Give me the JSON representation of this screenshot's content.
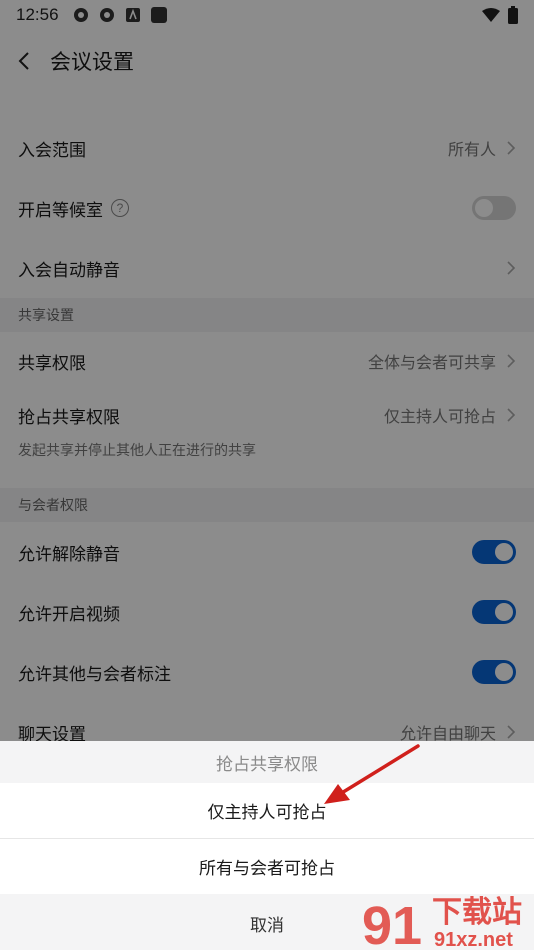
{
  "status_bar": {
    "time": "12:56"
  },
  "nav": {
    "title": "会议设置"
  },
  "rows": {
    "range_label": "入会范围",
    "range_value": "所有人",
    "waiting_label": "开启等候室",
    "help_glyph": "?",
    "auto_mute_label": "入会自动静音"
  },
  "share_section": {
    "header": "共享设置",
    "permission_label": "共享权限",
    "permission_value": "全体与会者可共享",
    "grab_label": "抢占共享权限",
    "grab_value": "仅主持人可抢占",
    "grab_desc": "发起共享并停止其他人正在进行的共享"
  },
  "attendee_section": {
    "header": "与会者权限",
    "unmute_label": "允许解除静音",
    "unmute_on": true,
    "video_label": "允许开启视频",
    "video_on": true,
    "annotate_label": "允许其他与会者标注",
    "annotate_on": true,
    "chat_label": "聊天设置",
    "chat_value": "允许自由聊天"
  },
  "sheet": {
    "title": "抢占共享权限",
    "option_1": "仅主持人可抢占",
    "option_2": "所有与会者可抢占",
    "cancel": "取消"
  },
  "watermark": {
    "text_main": "下载站",
    "text_url": "91xz.net",
    "logo_text": "91"
  },
  "colors": {
    "toggle_on": "#0a64d6",
    "arrow": "#d0201c",
    "watermark": "#e0413a"
  }
}
